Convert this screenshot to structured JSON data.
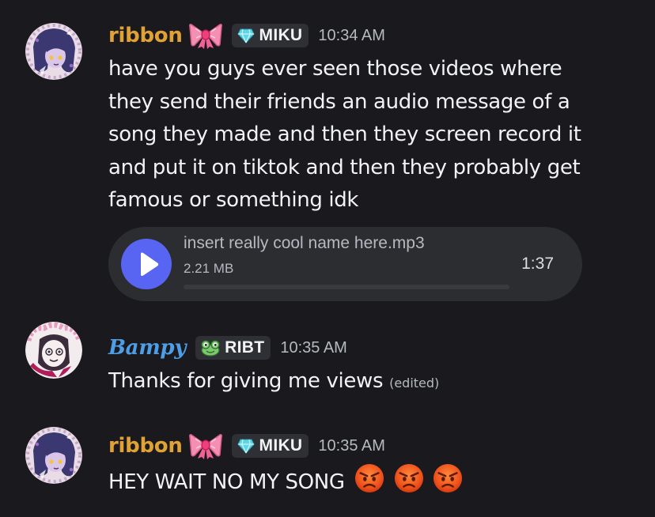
{
  "messages": [
    {
      "username": "ribbon",
      "decoration": "ribbon-bow-emoji",
      "tag": {
        "icon": "heart-diamond-icon",
        "label": "MIKU"
      },
      "timestamp": "10:34 AM",
      "lines": [
        "have you guys ever seen those videos where",
        "they send their friends an audio message of a",
        "song they made and then they screen record it",
        "and put it on tiktok and then they probably get",
        "famous or something idk"
      ],
      "attachment": {
        "type": "audio",
        "filename": "insert really cool name here.mp3",
        "size": "2.21 MB",
        "duration": "1:37",
        "progress": 0,
        "icon": "play-icon"
      }
    },
    {
      "username": "Bampy",
      "tag": {
        "icon": "frog-icon",
        "label": "RIBT"
      },
      "timestamp": "10:35 AM",
      "text": "Thanks for giving me views",
      "edited": "(edited)"
    },
    {
      "username": "ribbon",
      "decoration": "ribbon-bow-emoji",
      "tag": {
        "icon": "heart-diamond-icon",
        "label": "MIKU"
      },
      "timestamp": "10:35 AM",
      "text": "HEY WAIT NO MY SONG",
      "emojis": [
        "angry-face-emoji",
        "angry-face-emoji",
        "angry-face-emoji"
      ]
    }
  ],
  "colors": {
    "background": "#1a1a1e",
    "ribbon_name": "#e0a235",
    "bampy_name": "#4d9de7",
    "accent": "#5865f2",
    "tag_bg": "#2e3035",
    "attachment_bg": "#2b2d31"
  }
}
